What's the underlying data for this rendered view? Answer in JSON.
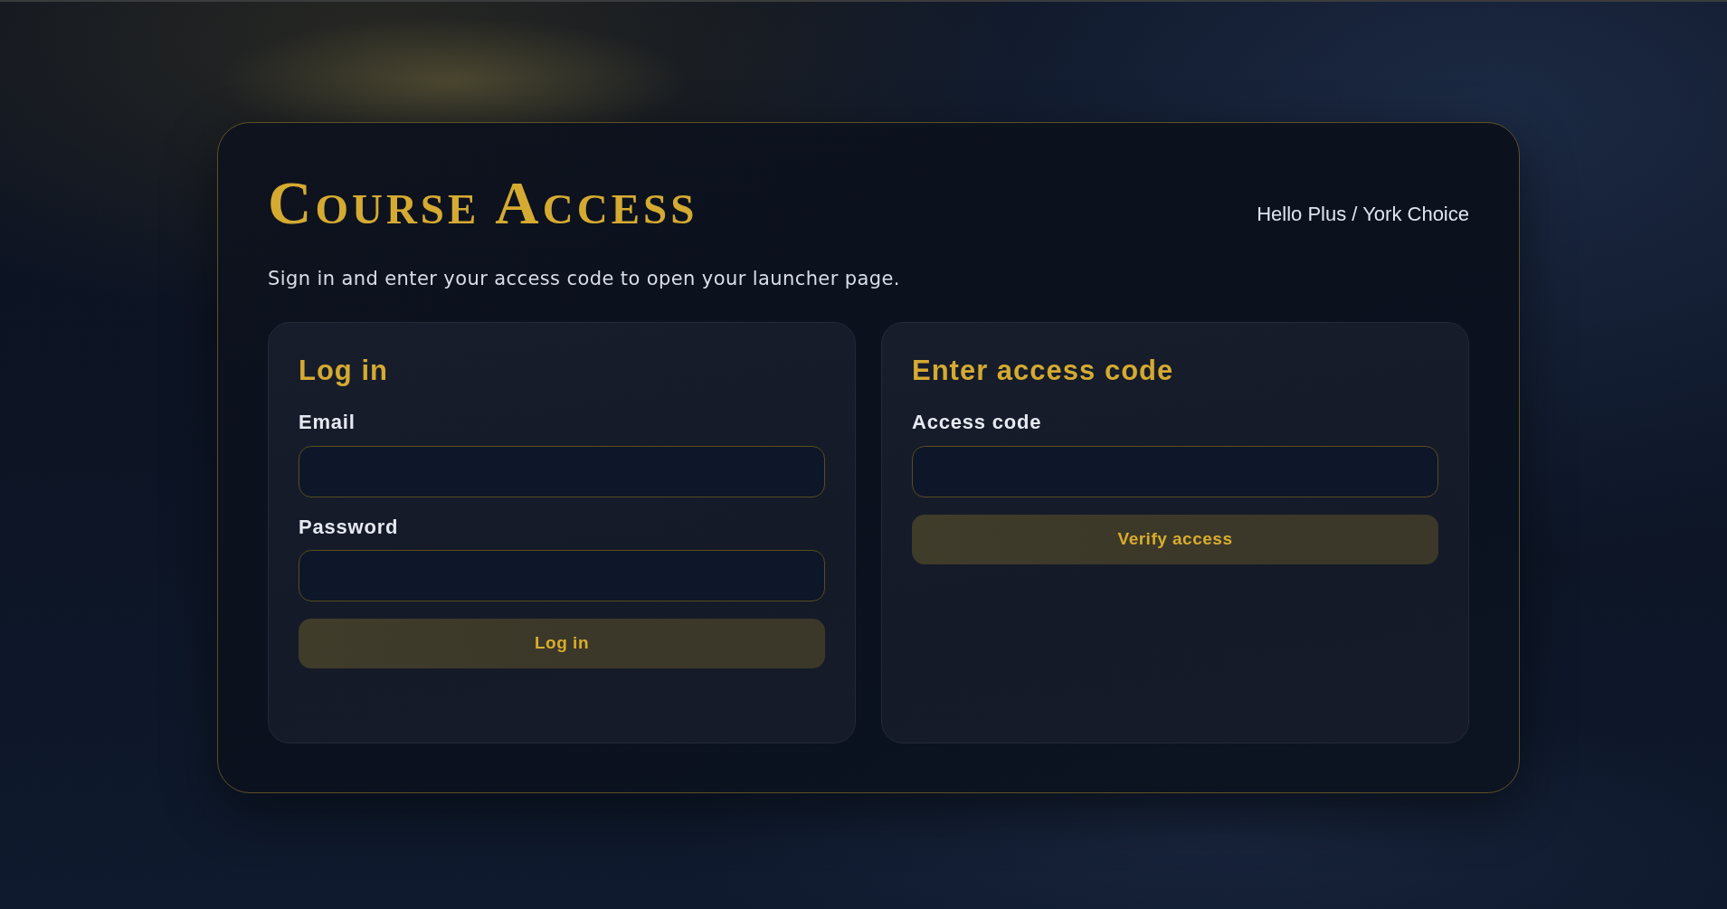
{
  "header": {
    "title": "Course Access",
    "brand": "Hello Plus / York Choice",
    "subtitle": "Sign in and enter your access code to open your launcher page."
  },
  "panels": [
    {
      "title": "Log in",
      "fields": [
        {
          "label": "Email"
        },
        {
          "label": "Password"
        }
      ],
      "button": "Log in"
    },
    {
      "title": "Enter access code",
      "fields": [
        {
          "label": "Access code"
        }
      ],
      "button": "Verify access"
    }
  ]
}
